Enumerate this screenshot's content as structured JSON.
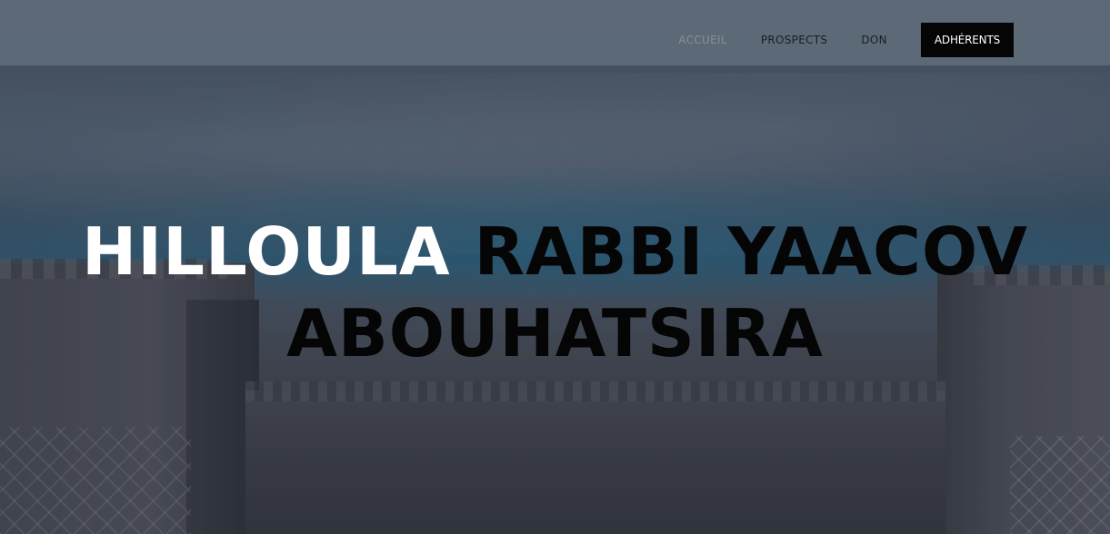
{
  "nav": {
    "items": [
      {
        "label": "ACCUEIL",
        "active": true
      },
      {
        "label": "PROSPECTS",
        "active": false
      },
      {
        "label": "DON",
        "active": false
      }
    ],
    "cta_label": "ADHÉRENTS"
  },
  "hero": {
    "title_highlight": "HILLOULA",
    "title_line1_rest": "RABBI YAACOV",
    "title_line2": "ABOUHATSIRA"
  },
  "colors": {
    "header_bg": "#606c7a",
    "cta_bg": "#050505",
    "title_highlight": "#ffffff",
    "title_main": "#050505",
    "nav_active": "#8a8f98"
  }
}
